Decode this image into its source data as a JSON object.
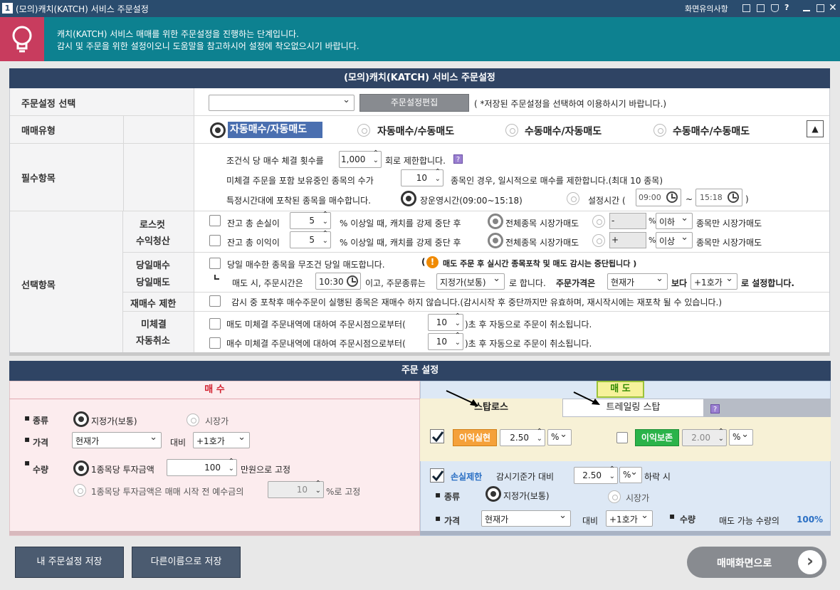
{
  "window": {
    "number": "1",
    "title": "(모의)캐치(KATCH) 서비스 주문설정",
    "notice_link": "화면유의사항",
    "help": "?"
  },
  "banner": {
    "line1": "캐치(KATCH) 서비스 매매를 위한 주문설정을 진행하는 단계입니다.",
    "line2": "감시 및 주문을 위한 설정이오니 도움말을 참고하시어 설정에 착오없으시기 바랍니다."
  },
  "top": {
    "header": "(모의)캐치(KATCH) 서비스 주문설정",
    "select_label": "주문설정 선택",
    "select_value": "",
    "edit_button": "주문설정편집",
    "select_hint": "( *저장된 주문설정을 선택하여 이용하시기 바랍니다.)",
    "type_label": "매매유형",
    "types": [
      "자동매수/자동매도",
      "자동매수/수동매도",
      "수동매수/자동매도",
      "수동매수/수동매도"
    ],
    "collapse": "▲",
    "required_label": "필수항목",
    "req1a": "조건식 당 매수 체결 횟수를",
    "req1_value": "1,000",
    "req1b": "회로 제한합니다.",
    "qmark": "?",
    "req2a": "미체결 주문을 포함 보유중인 종목의 수가",
    "req2_value": "10",
    "req2b": "종목인 경우, 일시적으로 매수를 제한합니다.(최대 10 종목)",
    "req3a": "특정시간대에 포착된 종목을 매수합니다.",
    "req3_opt1": "장운영시간(09:00~15:18)",
    "req3_opt2": "설정시간 (",
    "time_from": "09:00",
    "tilde": "~",
    "time_to": "15:18",
    "close_paren": ")",
    "optional_label": "선택항목",
    "losscut_label1": "로스컷",
    "losscut_label2": "수익청산",
    "lc1a": "잔고 총 손실이",
    "lc1_value": "5",
    "lc1b": "% 이상일 때, 캐치를 강제 중단 후",
    "lc1_opt": "전체종목 시장가매도",
    "lc1_sign": "-",
    "lc1_pct": "%",
    "lc1_sel": "이하",
    "lc1_c": "종목만 시장가매도",
    "lc2a": "잔고 총 이익이",
    "lc2_value": "5",
    "lc2b": "% 이상일 때, 캐치를 강제 중단 후",
    "lc2_opt": "전체종목 시장가매도",
    "lc2_sign": "+",
    "lc2_pct": "%",
    "lc2_sel": "이상",
    "lc2_c": "종목만 시장가매도",
    "sameday_label1": "당일매수",
    "sameday_label2": "당일매도",
    "sd1": "당일 매수한 종목을 무조건 당일 매도합니다.",
    "sd_warn_open": "(",
    "sd_warn": "매도 주문 후 실시간 종목포착 및 매도 감시는 중단됩니다 )",
    "sd2a": "매도 시, 주문시간은",
    "sd2_time": "10:30",
    "sd2b": "이고, 주문종류는",
    "sd2_type": "지정가(보통)",
    "sd2c": "로 합니다.",
    "sd2d": "주문가격은",
    "sd2_price": "현재가",
    "sd2e": "보다",
    "sd2_tick": "+1호가",
    "sd2f": "로 설정합니다.",
    "rebuy_label": "재매수 제한",
    "rebuy_text": "감시 중 포착후 매수주문이 실행된 종목은 재매수 하지 않습니다.(감시시작 후 중단까지만 유효하며, 재시작시에는 재포착 될 수 있습니다.)",
    "cancel_label1": "미체결",
    "cancel_label2": "자동취소",
    "c1a": "매도 미체결 주문내역에 대하여 주문시점으로부터(",
    "c1_value": "10",
    "c1b": ")초 후 자동으로 주문이 취소됩니다.",
    "c2a": "매수 미체결 주문내역에 대하여 주문시점으로부터(",
    "c2_value": "10",
    "c2b": ")초 후 자동으로 주문이 취소됩니다."
  },
  "order": {
    "header": "주문 설정",
    "buy": {
      "title": "매 수",
      "kind_label": "종류",
      "kind_opt1": "지정가(보통)",
      "kind_opt2": "시장가",
      "price_label": "가격",
      "price_value": "현재가",
      "vs": "대비",
      "tick_value": "+1호가",
      "qty_label": "수량",
      "qty1a": "1종목당 투자금액",
      "qty1_value": "100",
      "qty1b": "만원으로 고정",
      "qty2a": "1종목당 투자금액은 매매 시작 전 예수금의",
      "qty2_value": "10",
      "qty2b": "%로 고정"
    },
    "sell": {
      "title": "매 도",
      "tab1": "스탑로스",
      "tab2": "트레일링 스탑",
      "qmark": "?",
      "profit_label": "이익실현",
      "profit_value": "2.50",
      "profit_unit": "%",
      "keep_label": "이익보존",
      "keep_value": "2.00",
      "keep_unit": "%",
      "loss_label": "손실제한",
      "loss_text": "감시기준가 대비",
      "loss_value": "2.50",
      "loss_unit": "%",
      "loss_b": "하락 시",
      "kind_label": "종류",
      "kind_opt1": "지정가(보통)",
      "kind_opt2": "시장가",
      "price_label": "가격",
      "price_value": "현재가",
      "vs": "대비",
      "tick_value": "+1호가",
      "qty_label": "수량",
      "qty_text": "매도 가능 수량의",
      "qty_pct": "100%"
    }
  },
  "footer": {
    "save": "내 주문설정 저장",
    "save_as": "다른이름으로 저장",
    "go_trade": "매매화면으로",
    "go_icon": "›"
  }
}
